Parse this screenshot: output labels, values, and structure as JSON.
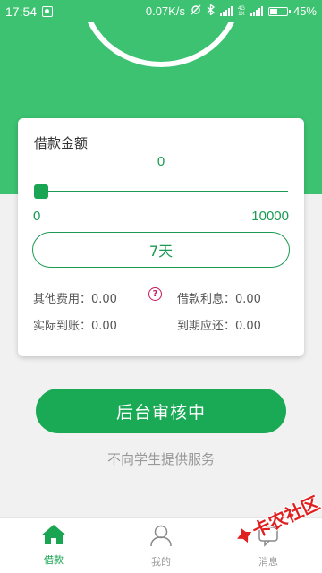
{
  "statusbar": {
    "time": "17:54",
    "speed": "0.07K/s",
    "network": "4G",
    "network_sub": "1X",
    "battery_percent": "45%",
    "battery_level": 0.45
  },
  "loan_card": {
    "amount_label": "借款金额",
    "amount_value": "0",
    "slider_min": "0",
    "slider_max": "10000",
    "slider_value": 0,
    "term_label": "7天",
    "other_fees": "其他费用：0.00",
    "interest": "借款利息：0.00",
    "actual_received": "实际到账：0.00",
    "due_repay": "到期应还：0.00"
  },
  "action": {
    "status_label": "后台审核中",
    "notice": "不向学生提供服务"
  },
  "nav": {
    "items": [
      {
        "label": "借款",
        "icon": "home-icon",
        "active": true
      },
      {
        "label": "我的",
        "icon": "user-icon",
        "active": false
      },
      {
        "label": "消息",
        "icon": "message-icon",
        "active": false
      }
    ]
  },
  "watermark": {
    "text": "卡农社区"
  },
  "colors": {
    "primary": "#3cc270",
    "accent": "#1aa552",
    "text_green": "#1a9a52",
    "help": "#c2185b",
    "watermark": "#e02020"
  }
}
